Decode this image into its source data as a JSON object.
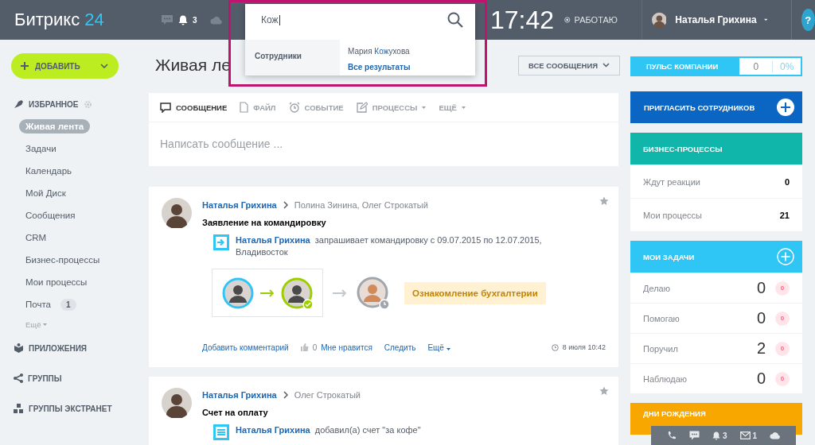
{
  "header": {
    "logo_text": "Битрикс",
    "logo_number": "24",
    "notification_count": "3",
    "clock": "17:42",
    "work_status": "РАБОТАЮ",
    "user_name": "Наталья Грихина",
    "help": "?"
  },
  "search": {
    "value": "Кож",
    "category": "Сотрудники",
    "result": {
      "before": "Мария ",
      "match": "Кож",
      "after": "ухова"
    },
    "all_results": "Все результаты"
  },
  "add_button": "ДОБАВИТЬ",
  "page_title": "Живая ле",
  "filter": "ВСЕ СООБЩЕНИЯ",
  "pulse": {
    "label": "ПУЛЬС КОМПАНИИ",
    "value": "0",
    "percent": "0%"
  },
  "sidebar": {
    "favorites": "ИЗБРАННОЕ",
    "items": [
      {
        "label": "Живая лента",
        "selected": true
      },
      {
        "label": "Задачи",
        "selected": false
      },
      {
        "label": "Календарь",
        "selected": false
      },
      {
        "label": "Мой Диск",
        "selected": false
      },
      {
        "label": "Сообщения",
        "selected": false
      },
      {
        "label": "CRM",
        "selected": false
      },
      {
        "label": "Бизнес-процессы",
        "selected": false
      },
      {
        "label": "Мои процессы",
        "selected": false
      },
      {
        "label": "Почта",
        "selected": false,
        "count": "1"
      }
    ],
    "more": "Ещё",
    "sections": [
      {
        "kind": "apps",
        "label": "ПРИЛОЖЕНИЯ"
      },
      {
        "kind": "groups",
        "label": "ГРУППЫ"
      },
      {
        "kind": "extranet",
        "label": "ГРУППЫ ЭКСТРАНЕТ"
      }
    ]
  },
  "composer": {
    "tabs": [
      {
        "kind": "message",
        "label": "СООБЩЕНИЕ",
        "selected": true,
        "dropdown": false
      },
      {
        "kind": "file",
        "label": "ФАЙЛ",
        "selected": false,
        "dropdown": false
      },
      {
        "kind": "event",
        "label": "СОБЫТИЕ",
        "selected": false,
        "dropdown": false
      },
      {
        "kind": "process",
        "label": "ПРОЦЕССЫ",
        "selected": false,
        "dropdown": true
      },
      {
        "kind": "more",
        "label": "ЕЩЁ",
        "selected": false,
        "dropdown": true
      }
    ],
    "placeholder": "Написать сообщение ..."
  },
  "posts": [
    {
      "author": "Наталья Грихина",
      "recipients": "Полина Зинина, Олег Строкатый",
      "title": "Заявление на командировку",
      "entry": {
        "kind": "trip",
        "author": "Наталья Грихина",
        "text": "запрашивает командировку с 09.07.2015 по 12.07.2015, Владивосток"
      },
      "workflow": {
        "steps": [
          {
            "approved": false,
            "waiting": false
          },
          {
            "approved": true,
            "waiting": false
          },
          {
            "approved": false,
            "waiting": true
          }
        ],
        "status": "Ознакомление бухгалтерии"
      },
      "footer": {
        "comment": "Добавить комментарий",
        "like_count": "0",
        "like": "Мне нравится",
        "follow": "Следить",
        "more": "Ещё",
        "date": "8 июля 10:42"
      }
    },
    {
      "author": "Наталья Грихина",
      "recipients": "Олег Строкатый",
      "title": "Счет на оплату",
      "entry": {
        "kind": "invoice",
        "author": "Наталья Грихина",
        "text": "добавил(а) счет \"за кофе\""
      }
    }
  ],
  "invite": "ПРИГЛАСИТЬ СОТРУДНИКОВ",
  "business_processes": {
    "title": "БИЗНЕС-ПРОЦЕССЫ",
    "rows": [
      {
        "label": "Ждут реакции",
        "value": "0"
      },
      {
        "label": "Мои процессы",
        "value": "21"
      }
    ]
  },
  "my_tasks": {
    "title": "МОИ ЗАДАЧИ",
    "rows": [
      {
        "label": "Делаю",
        "value": "0",
        "counter": "0"
      },
      {
        "label": "Помогаю",
        "value": "0",
        "counter": "0"
      },
      {
        "label": "Поручил",
        "value": "2",
        "counter": "0"
      },
      {
        "label": "Наблюдаю",
        "value": "0",
        "counter": "0"
      }
    ]
  },
  "birthdays": {
    "title": "ДНИ РОЖДЕНИЯ"
  },
  "bottom_bar": {
    "notification_count": "3",
    "mail_count": "1"
  }
}
